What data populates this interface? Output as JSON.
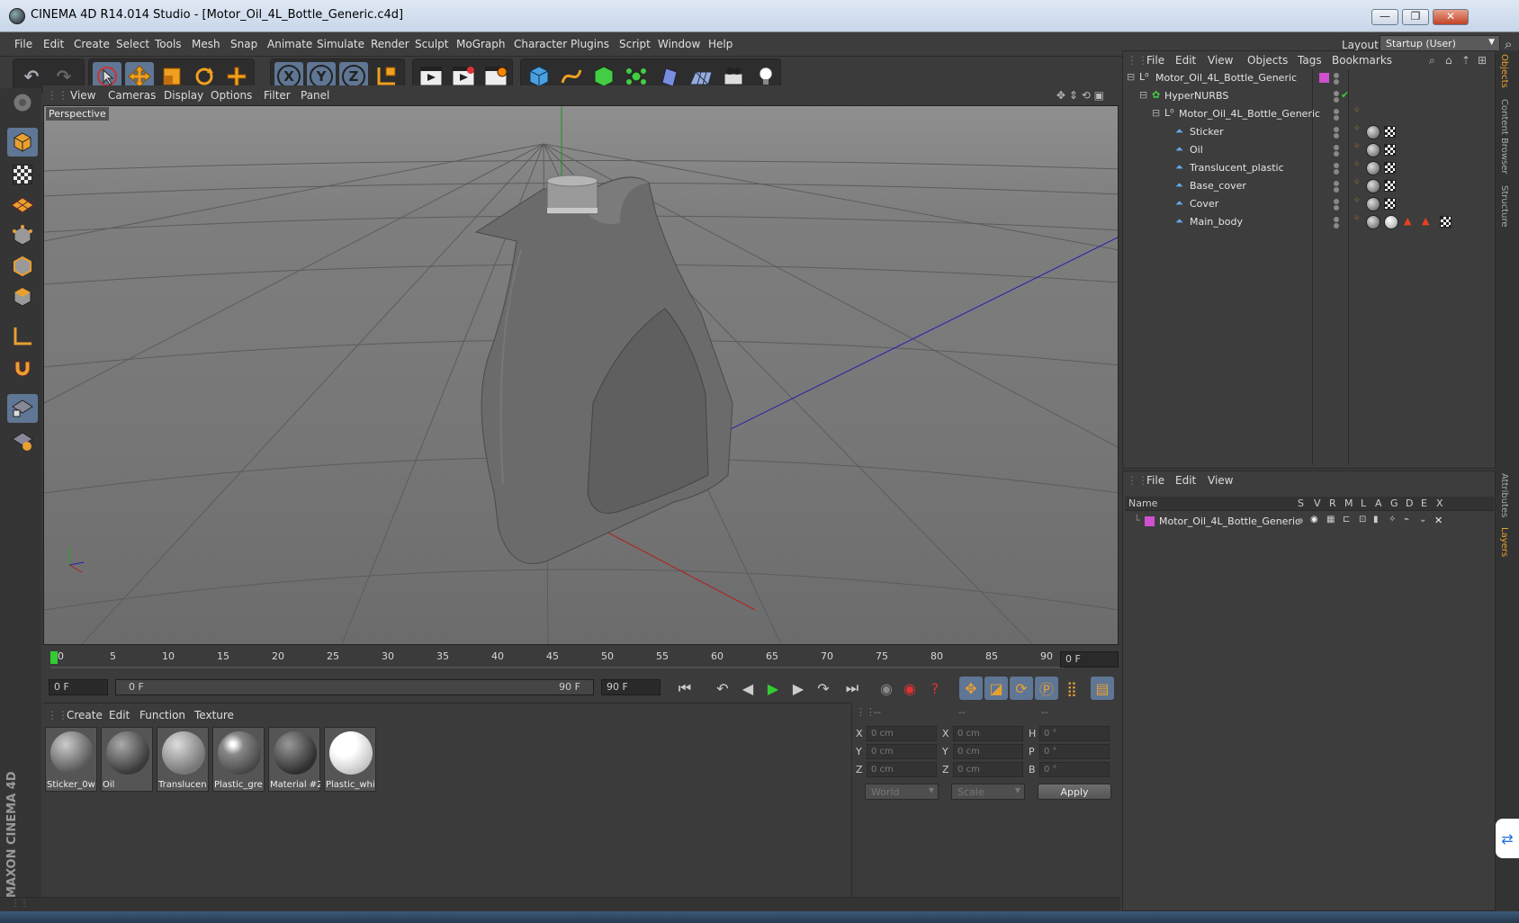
{
  "window": {
    "title": "CINEMA 4D R14.014 Studio - [Motor_Oil_4L_Bottle_Generic.c4d]",
    "controls": {
      "minimize": "—",
      "restore": "❐",
      "close": "✕"
    }
  },
  "menubar": {
    "items": [
      "File",
      "Edit",
      "Create",
      "Select",
      "Tools",
      "Mesh",
      "Snap",
      "Animate",
      "Simulate",
      "Render",
      "Sculpt",
      "MoGraph",
      "Character",
      "Plugins",
      "Script",
      "Window",
      "Help"
    ],
    "layout_label": "Layout:",
    "layout_value": "Startup (User)"
  },
  "toolbar": {
    "undo": "↶",
    "redo": "↷",
    "tools": [
      "select-icon",
      "move-icon",
      "scale-icon",
      "rotate-icon",
      "add-icon"
    ],
    "axes": [
      "X",
      "Y",
      "Z"
    ],
    "accent": "#5f7694"
  },
  "viewport": {
    "menu": [
      "View",
      "Cameras",
      "Display",
      "Options",
      "Filter",
      "Panel"
    ],
    "label": "Perspective"
  },
  "timeline": {
    "ticks": [
      "0",
      "5",
      "10",
      "15",
      "20",
      "25",
      "30",
      "35",
      "40",
      "45",
      "50",
      "55",
      "60",
      "65",
      "70",
      "75",
      "80",
      "85",
      "90"
    ],
    "current_frame": "0 F",
    "start_field": "0 F",
    "range_start": "0 F",
    "range_end": "90 F",
    "end_field": "90 F"
  },
  "materials": {
    "menu": [
      "Create",
      "Edit",
      "Function",
      "Texture"
    ],
    "items": [
      {
        "name": "Sticker_0w",
        "color": "#8a8a8a"
      },
      {
        "name": "Oil",
        "color": "#6d6d6d"
      },
      {
        "name": "Translucen",
        "color": "#9a9a9a"
      },
      {
        "name": "Plastic_gre",
        "color": "#7b7b7b"
      },
      {
        "name": "Material #2",
        "color": "#5e5e5e"
      },
      {
        "name": "Plastic_whi",
        "color": "#e8e8e8"
      }
    ]
  },
  "coordinates": {
    "headers": [
      "--",
      "--",
      "--"
    ],
    "rows": [
      {
        "l1": "X",
        "v1": "0 cm",
        "l2": "X",
        "v2": "0 cm",
        "l3": "H",
        "v3": "0 °"
      },
      {
        "l1": "Y",
        "v1": "0 cm",
        "l2": "Y",
        "v2": "0 cm",
        "l3": "P",
        "v3": "0 °"
      },
      {
        "l1": "Z",
        "v1": "0 cm",
        "l2": "Z",
        "v2": "0 cm",
        "l3": "B",
        "v3": "0 °"
      }
    ],
    "world": "World",
    "scale": "Scale",
    "apply": "Apply"
  },
  "objects": {
    "menu": [
      "File",
      "Edit",
      "View",
      "Objects",
      "Tags",
      "Bookmarks"
    ],
    "tree": [
      {
        "name": "Motor_Oil_4L_Bottle_Generic",
        "depth": 0,
        "type": "null"
      },
      {
        "name": "HyperNURBS",
        "depth": 1,
        "type": "nurbs"
      },
      {
        "name": "Motor_Oil_4L_Bottle_Generic",
        "depth": 2,
        "type": "null"
      },
      {
        "name": "Sticker",
        "depth": 3,
        "type": "poly"
      },
      {
        "name": "Oil",
        "depth": 3,
        "type": "poly"
      },
      {
        "name": "Translucent_plastic",
        "depth": 3,
        "type": "poly"
      },
      {
        "name": "Base_cover",
        "depth": 3,
        "type": "poly"
      },
      {
        "name": "Cover",
        "depth": 3,
        "type": "poly"
      },
      {
        "name": "Main_body",
        "depth": 3,
        "type": "poly"
      }
    ]
  },
  "layers": {
    "menu": [
      "File",
      "Edit",
      "View"
    ],
    "columns": [
      "Name",
      "S",
      "V",
      "R",
      "M",
      "L",
      "A",
      "G",
      "D",
      "E",
      "X"
    ],
    "rows": [
      {
        "name": "Motor_Oil_4L_Bottle_Generic",
        "color": "#d050d0"
      }
    ]
  },
  "sidetabs": [
    "Objects",
    "Content Browser",
    "Structure",
    "Attributes",
    "Layers"
  ],
  "branding": "MAXON CINEMA 4D"
}
